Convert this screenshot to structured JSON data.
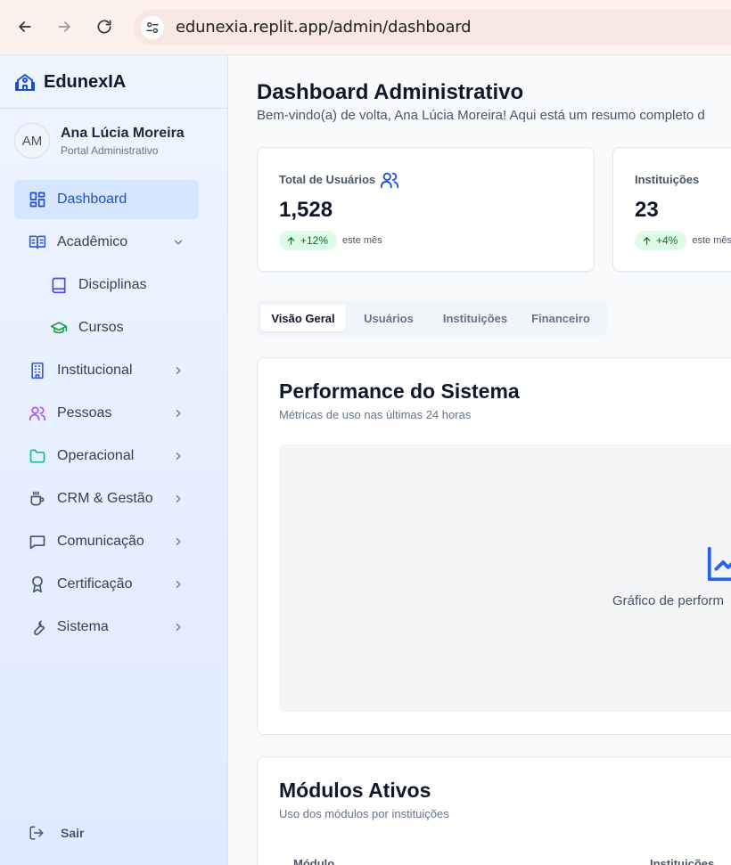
{
  "browser": {
    "url": "edunexia.replit.app/admin/dashboard"
  },
  "sidebar": {
    "brand": "EdunexIA",
    "user": {
      "initials": "AM",
      "name": "Ana Lúcia Moreira",
      "role": "Portal Administrativo"
    },
    "items": [
      {
        "label": "Dashboard",
        "icon": "dashboard-icon",
        "active": true
      },
      {
        "label": "Acadêmico",
        "icon": "book-open-icon",
        "expanded": true
      },
      {
        "label": "Disciplinas",
        "icon": "book-icon",
        "sub": true
      },
      {
        "label": "Cursos",
        "icon": "graduation-cap-icon",
        "sub": true
      },
      {
        "label": "Institucional",
        "icon": "building-icon"
      },
      {
        "label": "Pessoas",
        "icon": "users-icon"
      },
      {
        "label": "Operacional",
        "icon": "folder-icon"
      },
      {
        "label": "CRM & Gestão",
        "icon": "coffee-icon"
      },
      {
        "label": "Comunicação",
        "icon": "message-icon"
      },
      {
        "label": "Certificação",
        "icon": "award-icon"
      },
      {
        "label": "Sistema",
        "icon": "wrench-icon"
      }
    ],
    "logout": "Sair"
  },
  "main": {
    "title": "Dashboard Administrativo",
    "subtitle": "Bem-vindo(a) de volta, Ana Lúcia Moreira! Aqui está um resumo completo d",
    "stats": [
      {
        "label": "Total de Usuários",
        "value": "1,528",
        "change": "+12%",
        "note": "este mês",
        "icon": "users-icon"
      },
      {
        "label": "Instituições",
        "value": "23",
        "change": "+4%",
        "note": "este mês",
        "icon": "building-icon"
      }
    ],
    "tabs": [
      "Visão Geral",
      "Usuários",
      "Instituições",
      "Financeiro"
    ],
    "active_tab": "Visão Geral",
    "performance": {
      "title": "Performance do Sistema",
      "subtitle": "Métricas de uso nas últimas 24 horas",
      "placeholder": "Gráfico de perform"
    },
    "modules": {
      "title": "Módulos Ativos",
      "subtitle": "Uso dos módulos por instituições",
      "columns": [
        "Módulo",
        "Instituições"
      ]
    }
  },
  "colors": {
    "accent": "#1d4ed8",
    "active_bg": "#d6e6ff",
    "badge_bg": "#dcfce7",
    "badge_text": "#166534"
  }
}
